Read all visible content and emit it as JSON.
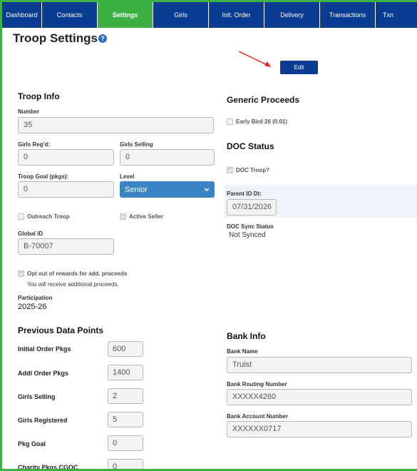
{
  "nav": {
    "tabs": [
      {
        "label": "Dashboard",
        "active": false
      },
      {
        "label": "Contacts",
        "active": false
      },
      {
        "label": "Settings",
        "active": true
      },
      {
        "label": "Girls",
        "active": false
      },
      {
        "label": "Init. Order",
        "active": false
      },
      {
        "label": "Delivery",
        "active": false
      },
      {
        "label": "Transactions",
        "active": false
      },
      {
        "label": "Txn",
        "active": false
      }
    ]
  },
  "header": {
    "title": "Troop Settings",
    "help_icon": "question-circle-icon"
  },
  "toolbar": {
    "edit_label": "Edit"
  },
  "troop_info": {
    "heading": "Troop Info",
    "number_label": "Number",
    "number_value": "35",
    "girls_regd_label": "Girls Reg'd:",
    "girls_regd_value": "0",
    "girls_selling_label": "Girls Selling",
    "girls_selling_value": "0",
    "troop_goal_label": "Troop Goal (pkgs):",
    "troop_goal_value": "0",
    "level_label": "Level",
    "level_value": "Senior",
    "outreach_label": "Outreach Troop",
    "active_seller_label": "Active Seller",
    "global_id_label": "Global ID",
    "global_id_value": "B-70007",
    "opt_out_label": "Opt out of rewards for add. proceeds",
    "opt_out_note": "You will receive additional proceeds.",
    "participation_label": "Participation",
    "participation_value": "2025-26"
  },
  "generic_proceeds": {
    "heading": "Generic Proceeds",
    "early_bird_label": "Early Bird 26 (0.01)"
  },
  "doc_status": {
    "heading": "DOC Status",
    "doc_troop_label": "DOC Troop?",
    "parent_io_label": "Parent IO Dt:",
    "parent_io_value": "07/31/2026",
    "sync_label": "DOC Sync Status",
    "sync_value": "Not Synced"
  },
  "previous_data_points": {
    "heading": "Previous Data Points",
    "rows": [
      {
        "label": "Initial Order Pkgs",
        "value": "600"
      },
      {
        "label": "Addl Order Pkgs",
        "value": "1400"
      },
      {
        "label": "Girls Selling",
        "value": "2"
      },
      {
        "label": "Girls Registered",
        "value": "5"
      },
      {
        "label": "Pkg Goal",
        "value": "0"
      },
      {
        "label": "Charity Pkgs CGOC",
        "value": "0"
      }
    ]
  },
  "bank_info": {
    "heading": "Bank Info",
    "bank_name_label": "Bank Name",
    "bank_name_value": "Truist",
    "routing_label": "Bank Routing Number",
    "routing_value": "XXXXX4260",
    "account_label": "Bank Account Number",
    "account_value": "XXXXXX0717"
  },
  "colors": {
    "nav_bg": "#0a3d91",
    "active_tab": "#3cb043",
    "frame": "#3cb043",
    "select_bg": "#3a84c4",
    "arrow": "#e02020"
  }
}
